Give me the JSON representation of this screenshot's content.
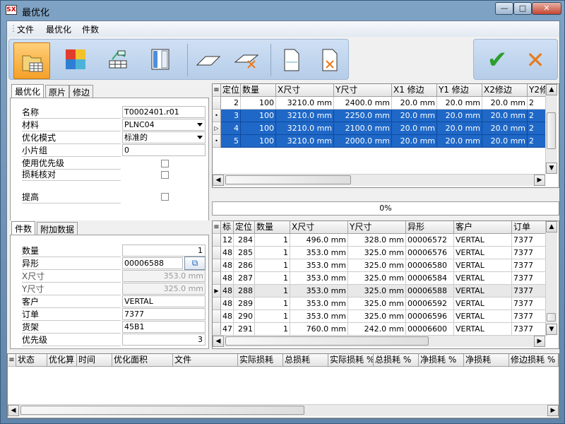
{
  "window": {
    "title": "最优化",
    "icon_text": "SX",
    "minimize": "—",
    "maximize": "□",
    "close": "✕"
  },
  "menu": [
    "文件",
    "最优化",
    "件数"
  ],
  "toolbar": {
    "icons": [
      "open-folder-icon",
      "color-palette-icon",
      "stack-pieces-icon",
      "panel-edge-icon",
      "parallelogram-icon",
      "parallelogram-remove-icon",
      "page-icon",
      "page-remove-icon"
    ],
    "ok": "✔",
    "cancel": "✕",
    "colors": {
      "ok": "#2e9d2e",
      "cancel": "#e8791a",
      "selected": "#f5a028"
    }
  },
  "top_panel": {
    "tabs": [
      "最优化",
      "原片",
      "修边"
    ],
    "fields": [
      {
        "label": "名称",
        "value": "T0002401.r01"
      },
      {
        "label": "材料",
        "value": "PLNC04"
      },
      {
        "label": "优化模式",
        "value": "标准的"
      },
      {
        "label": "小片组",
        "value": "0"
      },
      {
        "label": "使用优先级",
        "value": ""
      },
      {
        "label": "损耗核对",
        "value": ""
      },
      {
        "label": "提高",
        "value": ""
      }
    ]
  },
  "sheets_grid": {
    "columns": [
      "定位",
      "数量",
      "X尺寸",
      "Y尺寸",
      "X1 修边",
      "Y1 修边",
      "X2修边",
      "Y2修"
    ],
    "rows": [
      {
        "marker": "",
        "cells": [
          "2",
          "100",
          "3210.0 mm",
          "2400.0 mm",
          "20.0 mm",
          "20.0 mm",
          "20.0 mm",
          "2"
        ]
      },
      {
        "marker": "•",
        "cells": [
          "3",
          "100",
          "3210.0 mm",
          "2250.0 mm",
          "20.0 mm",
          "20.0 mm",
          "20.0 mm",
          "2"
        ]
      },
      {
        "marker": "▷",
        "cells": [
          "4",
          "100",
          "3210.0 mm",
          "2100.0 mm",
          "20.0 mm",
          "20.0 mm",
          "20.0 mm",
          "2"
        ]
      },
      {
        "marker": "•",
        "cells": [
          "5",
          "100",
          "3210.0 mm",
          "2000.0 mm",
          "20.0 mm",
          "20.0 mm",
          "20.0 mm",
          "2"
        ]
      }
    ]
  },
  "progress": {
    "text": "0%",
    "value": 0
  },
  "mid_panel": {
    "tabs": [
      "件数",
      "附加数据"
    ],
    "fields": [
      {
        "label": "数量",
        "value": "1"
      },
      {
        "label": "异形",
        "value": "00006588"
      },
      {
        "label": "X尺寸",
        "value": "353.0 mm"
      },
      {
        "label": "Y尺寸",
        "value": "325.0 mm"
      },
      {
        "label": "客户",
        "value": "VERTAL"
      },
      {
        "label": "订单",
        "value": "7377"
      },
      {
        "label": "货架",
        "value": "45B1"
      },
      {
        "label": "优先级",
        "value": "3"
      }
    ]
  },
  "pieces_grid": {
    "columns": [
      "标",
      "定位",
      "数量",
      "X尺寸",
      "Y尺寸",
      "异形",
      "客户",
      "订单"
    ],
    "rows": [
      {
        "marker": "",
        "cells": [
          "12",
          "284",
          "1",
          "496.0 mm",
          "328.0 mm",
          "00006572",
          "VERTAL",
          "7377"
        ]
      },
      {
        "marker": "",
        "cells": [
          "48",
          "285",
          "1",
          "353.0 mm",
          "325.0 mm",
          "00006576",
          "VERTAL",
          "7377"
        ]
      },
      {
        "marker": "",
        "cells": [
          "48",
          "286",
          "1",
          "353.0 mm",
          "325.0 mm",
          "00006580",
          "VERTAL",
          "7377"
        ]
      },
      {
        "marker": "",
        "cells": [
          "48",
          "287",
          "1",
          "353.0 mm",
          "325.0 mm",
          "00006584",
          "VERTAL",
          "7377"
        ]
      },
      {
        "marker": "▶",
        "cells": [
          "48",
          "288",
          "1",
          "353.0 mm",
          "325.0 mm",
          "00006588",
          "VERTAL",
          "7377"
        ]
      },
      {
        "marker": "",
        "cells": [
          "48",
          "289",
          "1",
          "353.0 mm",
          "325.0 mm",
          "00006592",
          "VERTAL",
          "7377"
        ]
      },
      {
        "marker": "",
        "cells": [
          "48",
          "290",
          "1",
          "353.0 mm",
          "325.0 mm",
          "00006596",
          "VERTAL",
          "7377"
        ]
      },
      {
        "marker": "",
        "cells": [
          "47",
          "291",
          "1",
          "760.0 mm",
          "242.0 mm",
          "00006600",
          "VERTAL",
          "7377"
        ]
      }
    ]
  },
  "results_grid": {
    "columns": [
      "状态",
      "优化算",
      "时间",
      "优化面积",
      "文件",
      "实际损耗",
      "总损耗",
      "实际损耗 %",
      "总损耗 %",
      "净损耗 %",
      "净损耗",
      "修边损耗 %"
    ]
  },
  "scroll": {
    "up": "▲",
    "down": "▼",
    "left": "◀",
    "right": "▶",
    "grid_icon": "≡"
  }
}
